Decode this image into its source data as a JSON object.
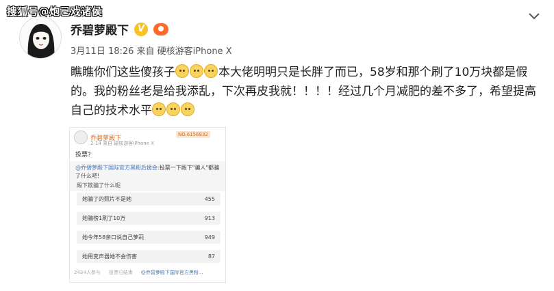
{
  "watermark": "搜狐号@炮己戏诸侯",
  "post": {
    "username": "乔碧萝殿下",
    "verified_badge": "V",
    "meta": "3月11日 18:26 来自 硬核游客iPhone X",
    "text_lines": [
      "瞧瞧你们这些傻孩子",
      "本大佬明明只是长胖了而已，58岁和那个刷了10万块都是假的。我的粉丝老是给我添乱，下次再皮我就！！！！经过几个月减肥的差不多了，希望提高自己的技术水平"
    ]
  },
  "embed": {
    "username": "乔碧萝殿下",
    "no_badge": "NO.6156832",
    "meta": "2-14  来自 硬核游客iPhone X",
    "question": "投票?",
    "share_prefix": "@乔碧萝殿下国际官方黑粉后援会",
    "share_text": ":投票一下殿下\"骗人\"都骗了什么吧!",
    "poll_title": "殿下欺骗了什么呢",
    "options": [
      {
        "label": "她骗了的照片不是她",
        "count": "455"
      },
      {
        "label": "她骗榜1刷了10万",
        "count": "913"
      },
      {
        "label": "她今年58亲口说自己萝莉",
        "count": "949"
      },
      {
        "label": "她用变声器她不会伤害",
        "count": "87"
      }
    ],
    "footer_left": "2434人参与",
    "footer_mid": "投票已结束",
    "footer_link": "@乔碧萝殿下国际官方黑粉..."
  },
  "icons": {
    "chevron": "chevron-down-icon",
    "emoji": "doge-emoji-icon"
  }
}
